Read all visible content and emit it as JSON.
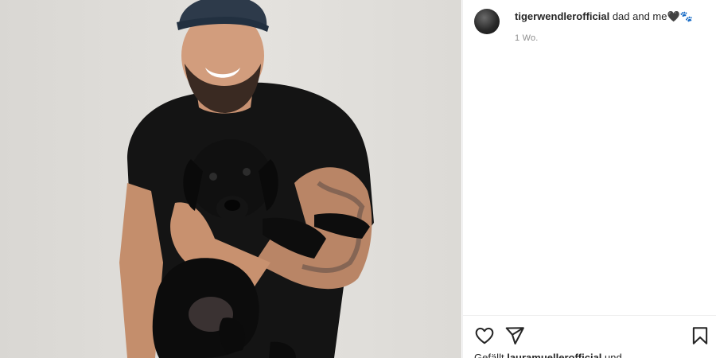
{
  "post": {
    "username": "tigerwendlerofficial",
    "caption": "dad and me🖤🐾",
    "time": "1 Wo."
  },
  "actions": {
    "like_icon": "heart-icon",
    "share_icon": "paper-plane-icon",
    "save_icon": "bookmark-icon"
  },
  "likes": {
    "prefix": "Gefällt",
    "user": "lauramuellerofficial",
    "suffix": "und"
  },
  "colors": {
    "text": "#262626",
    "secondary": "#8e8e8e",
    "divider": "#efefef"
  }
}
